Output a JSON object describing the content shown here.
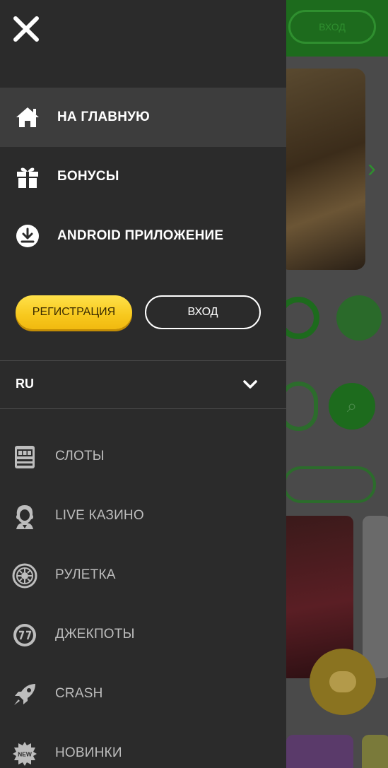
{
  "menu": {
    "close_icon": "close-icon",
    "nav_items": [
      {
        "label": "НА ГЛАВНУЮ",
        "icon": "home-icon",
        "active": true
      },
      {
        "label": "БОНУСЫ",
        "icon": "gift-icon",
        "active": false
      },
      {
        "label": "ANDROID ПРИЛОЖЕНИЕ",
        "icon": "download-icon",
        "active": false
      }
    ],
    "register_label": "РЕГИСТРАЦИЯ",
    "login_label": "ВХОД",
    "language": "RU",
    "categories": [
      {
        "label": "СЛОТЫ",
        "icon": "slot-machine-icon"
      },
      {
        "label": "LIVE КАЗИНО",
        "icon": "live-dealer-icon"
      },
      {
        "label": "РУЛЕТКА",
        "icon": "roulette-icon"
      },
      {
        "label": "ДЖЕКПОТЫ",
        "icon": "jackpot-77-icon"
      },
      {
        "label": "CRASH",
        "icon": "rocket-icon"
      },
      {
        "label": "НОВИНКИ",
        "icon": "new-badge-icon"
      }
    ]
  },
  "background": {
    "header_login_label": "ВХОД"
  },
  "colors": {
    "drawer_bg": "#2b2b2b",
    "active_item_bg": "#3d3d3d",
    "accent_yellow": "#f7c81d",
    "brand_green": "#1d6b1d",
    "category_text": "#bdbdbd"
  }
}
